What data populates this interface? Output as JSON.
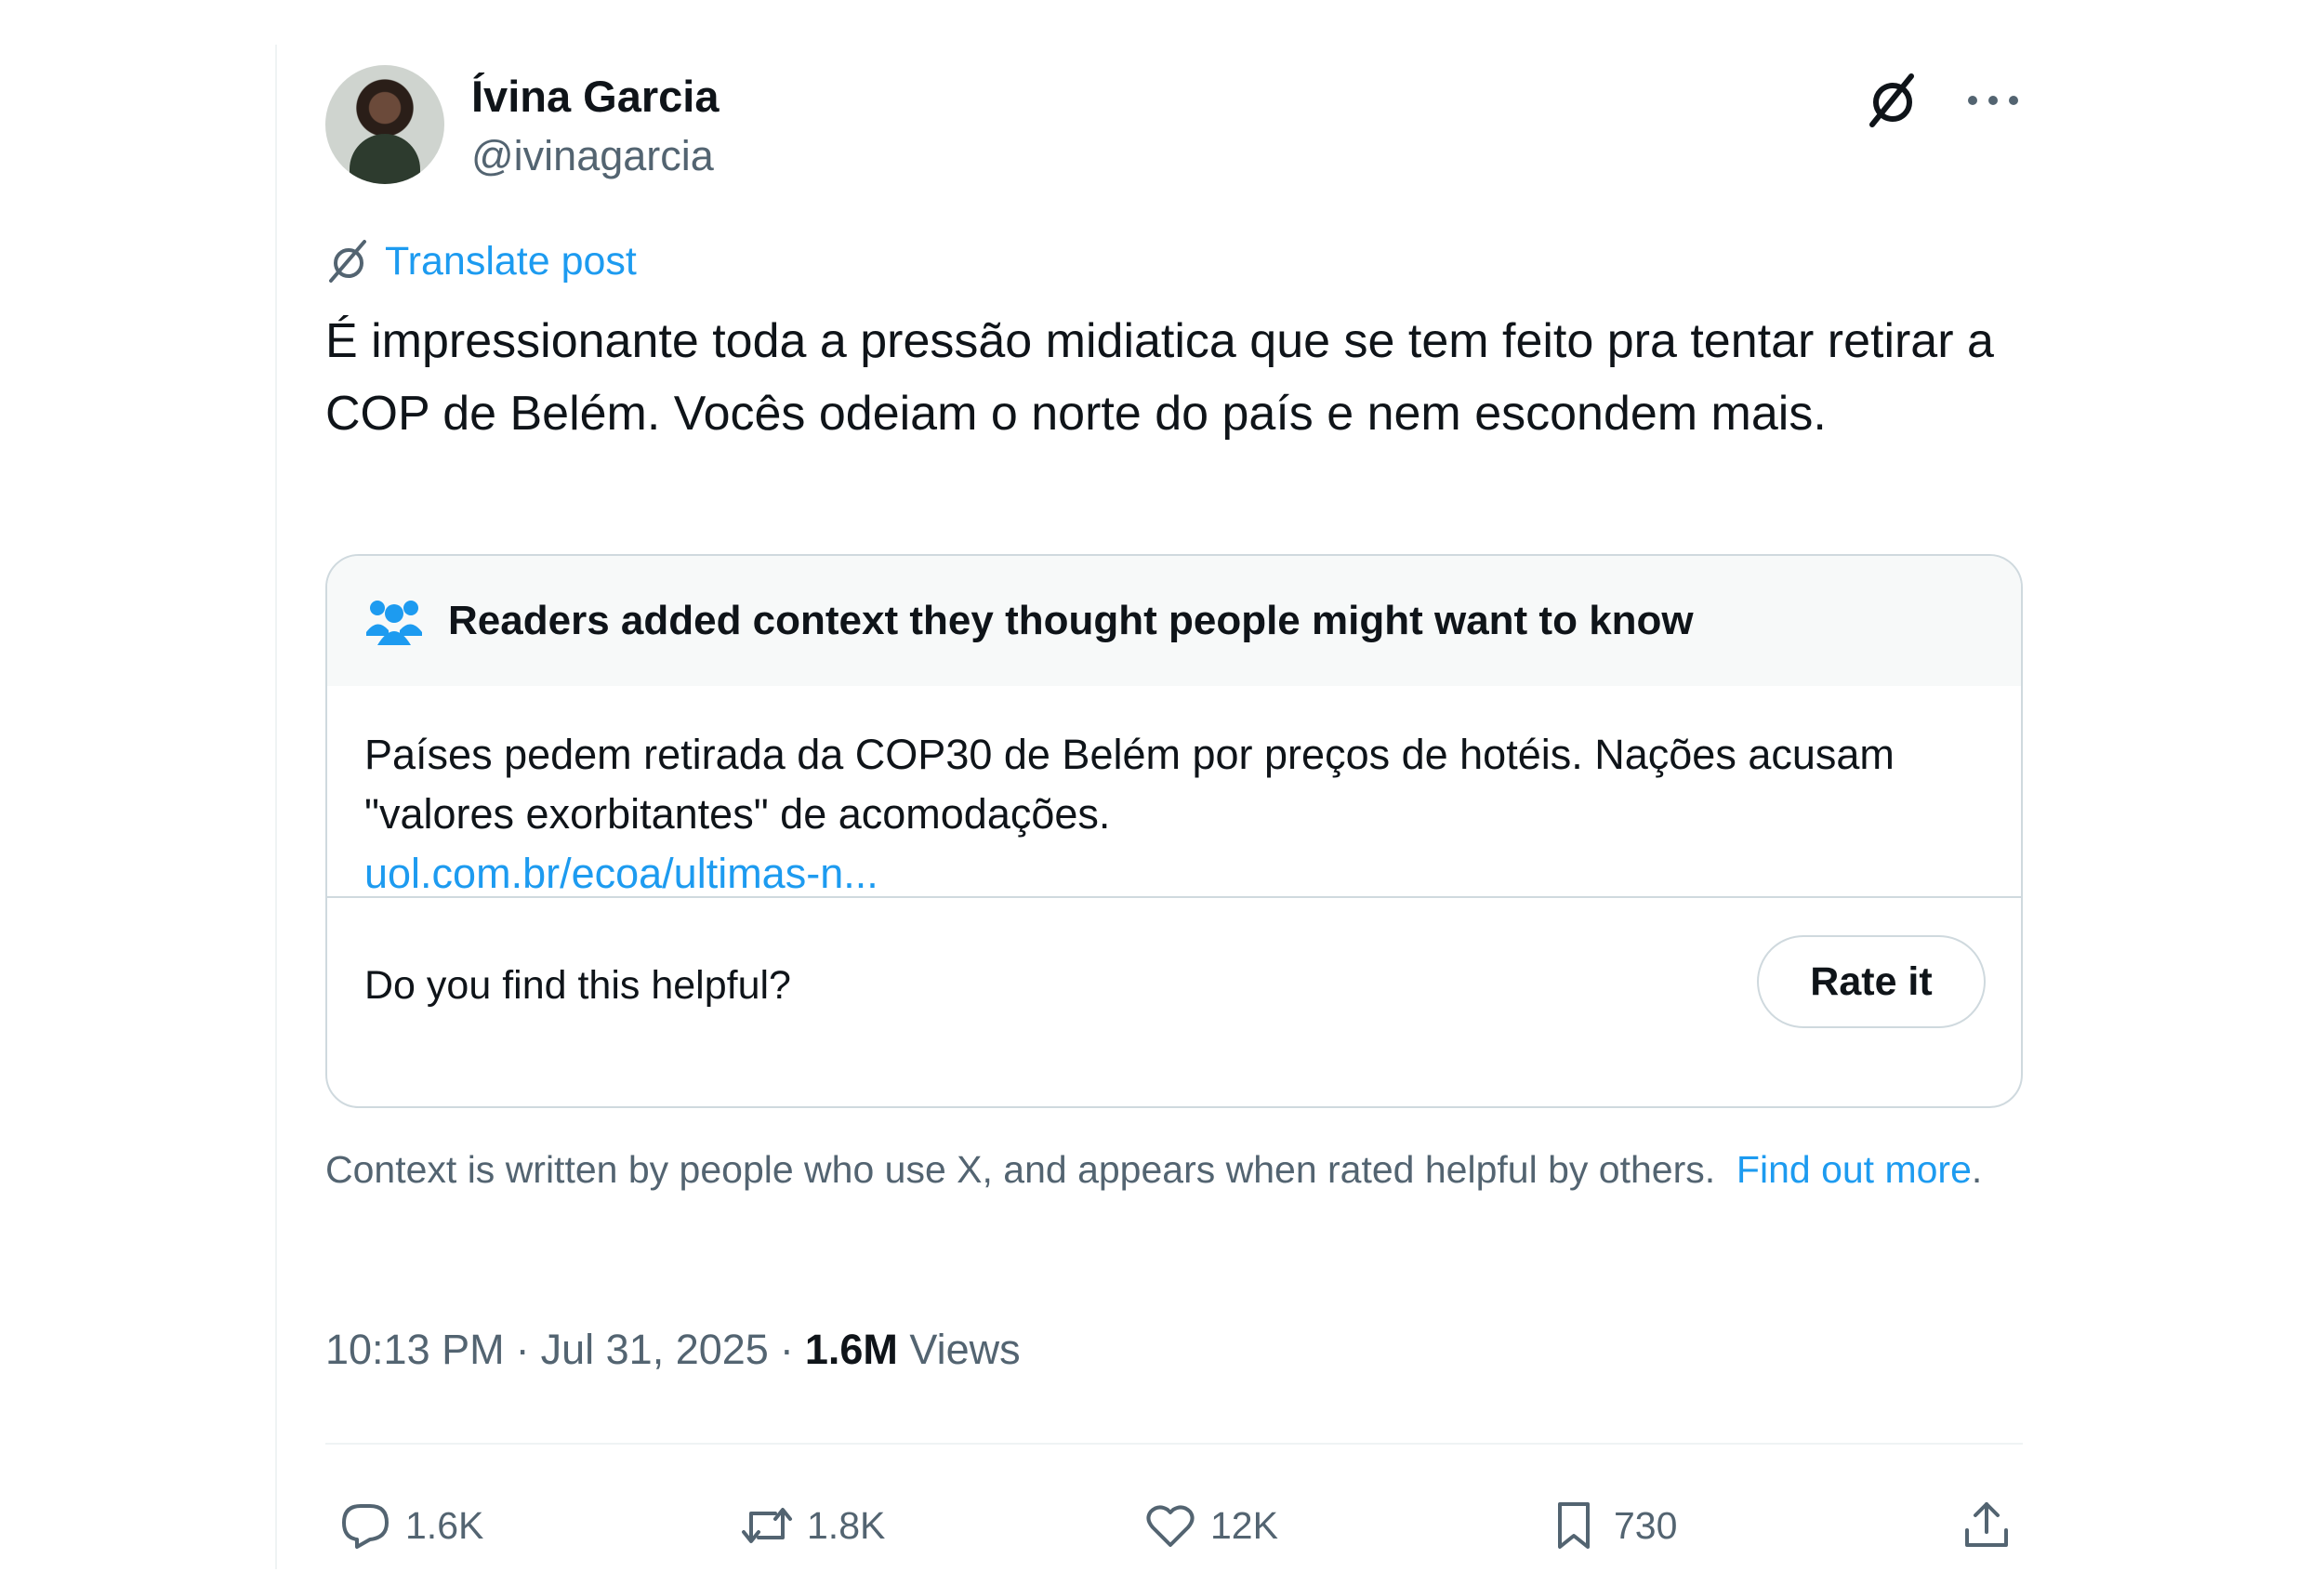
{
  "author": {
    "name": "Ívina Garcia",
    "handle": "@ivinagarcia",
    "avatar": "avatar"
  },
  "translate_label": "Translate post",
  "post_text": "É impressionante toda a pressão midiatica que se tem feito pra tentar retirar a COP de Belém. Vocês odeiam o norte do país e nem escondem mais.",
  "community_note": {
    "title": "Readers added context they thought people might want to know",
    "body": "Países pedem retirada da COP30 de Belém por preços de hotéis. Nações acusam \"valores exorbitantes\" de acomodações.",
    "link": "uol.com.br/ecoa/ultimas-n...",
    "question": "Do you find this helpful?",
    "rate_label": "Rate it"
  },
  "context_info": {
    "text": "Context is written by people who use X, and appears when rated helpful by others.",
    "link_label": "Find out more",
    "period": "."
  },
  "meta": {
    "time": "10:13 PM",
    "separator": "·",
    "date": "Jul 31, 2025",
    "views_count": "1.6M",
    "views_label": "Views"
  },
  "actions": {
    "replies": "1.6K",
    "reposts": "1.8K",
    "likes": "12K",
    "bookmarks": "730"
  },
  "colors": {
    "accent": "#1d9bf0",
    "text": "#0f1419",
    "secondary": "#536471",
    "border": "#cfd9de"
  },
  "icons": [
    "grok-icon",
    "more-icon",
    "translate-icon",
    "people-icon",
    "reply-icon",
    "repost-icon",
    "like-icon",
    "bookmark-icon",
    "share-icon"
  ]
}
